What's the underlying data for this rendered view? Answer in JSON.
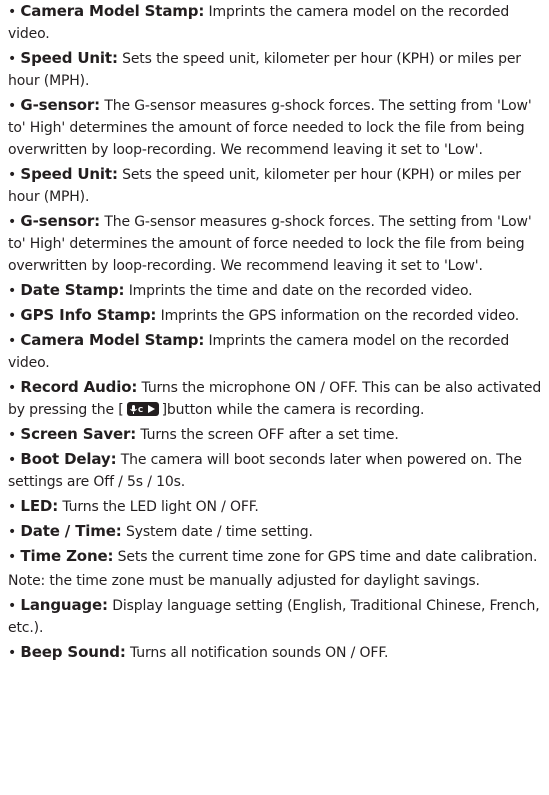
{
  "items": [
    {
      "bullet": "•",
      "term": "Camera Model Stamp:",
      "desc": "Imprints the camera model on the recorded video."
    },
    {
      "bullet": "•",
      "term": "Speed Unit:",
      "desc": "Sets the speed unit, kilometer per hour (KPH) or miles per hour (MPH)."
    },
    {
      "bullet": "•",
      "term": "G-sensor:",
      "desc": "The G-sensor measures g-shock forces. The setting from 'Low' to' High' determines the amount of force needed to lock the file from being overwritten by loop-recording. We recommend leaving it set to 'Low'."
    },
    {
      "bullet": "•",
      "term": "Speed Unit:",
      "desc": "Sets the speed unit, kilometer per hour (KPH) or miles per hour (MPH)."
    },
    {
      "bullet": "•",
      "term": "G-sensor:",
      "desc": "The G-sensor measures g-shock forces. The setting from 'Low' to' High' determines the amount of force needed to lock the file from being overwritten by loop-recording. We recommend leaving it set to 'Low'."
    },
    {
      "bullet": "•",
      "term": "Date Stamp:",
      "desc": "Imprints the time and date on the recorded video."
    },
    {
      "bullet": "•",
      "term": "GPS Info Stamp:",
      "desc": "Imprints the GPS information on the recorded video."
    },
    {
      "bullet": "•",
      "term": "Camera Model Stamp:",
      "desc": "Imprints the camera model on the recorded video."
    }
  ],
  "record_audio": {
    "bullet": "•",
    "term": "Record Audio:",
    "desc_before": "Turns the microphone ON / OFF. This can be also activated by pressing the [",
    "desc_after": "]button while the camera is recording.",
    "icon": "mic-button-icon"
  },
  "items2": [
    {
      "bullet": "•",
      "term": "Screen Saver:",
      "desc": "Turns the screen OFF after a set time."
    },
    {
      "bullet": "•",
      "term": "Boot Delay:",
      "desc": "The camera will boot seconds later when powered on. The settings are Off / 5s / 10s."
    },
    {
      "bullet": "•",
      "term": "LED:",
      "desc": "Turns the LED light ON / OFF."
    },
    {
      "bullet": "•",
      "term": "Date / Time:",
      "desc": "System date / time setting."
    },
    {
      "bullet": "•",
      "term": "Time Zone:",
      "desc": "Sets the current time zone for GPS time and date calibration."
    }
  ],
  "note": "Note: the time zone must be manually adjusted for daylight savings.",
  "items3": [
    {
      "bullet": "•",
      "term": "Language:",
      "desc": "Display language setting (English, Traditional Chinese, French, etc.)."
    },
    {
      "bullet": "•",
      "term": "Beep Sound:",
      "desc": "Turns all notification sounds ON / OFF."
    }
  ]
}
